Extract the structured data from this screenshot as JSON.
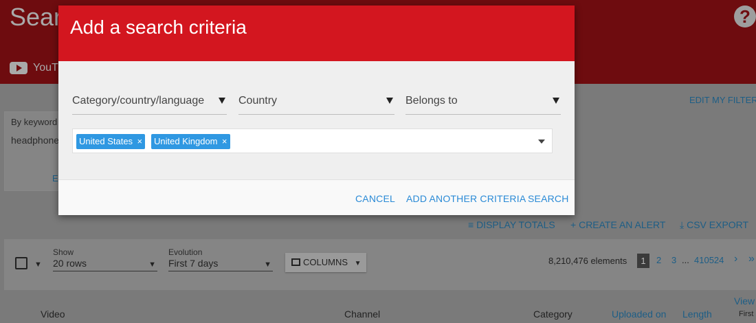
{
  "background": {
    "title": "Sear",
    "help_icon": "help-icon",
    "platform_label": "YouT",
    "filter_card": {
      "label": "By keyword",
      "value": "headphone",
      "edit": "E"
    },
    "edit_filters": "EDIT MY FILTER",
    "actions": {
      "display_totals": "DISPLAY TOTALS",
      "create_alert": "CREATE AN ALERT",
      "csv_export": "CSV EXPORT"
    },
    "toolbar": {
      "show_label": "Show",
      "show_value": "20 rows",
      "evolution_label": "Evolution",
      "evolution_value": "First 7 days",
      "columns": "COLUMNS",
      "elements": "8,210,476 elements",
      "pages": [
        "1",
        "2",
        "3",
        "...",
        "410524"
      ],
      "next": "›",
      "last": "»"
    },
    "columns": {
      "video": "Video",
      "channel": "Channel",
      "category": "Category",
      "uploaded_on": "Uploaded on",
      "length": "Length",
      "views": "View",
      "views_sub": "First"
    }
  },
  "modal": {
    "title": "Add a search criteria",
    "dropdowns": [
      {
        "label": "Category/country/language"
      },
      {
        "label": "Country"
      },
      {
        "label": "Belongs to"
      }
    ],
    "tags": [
      "United States",
      "United Kingdom"
    ],
    "tag_remove": "×",
    "footer": {
      "cancel": "CANCEL",
      "add_another": "ADD ANOTHER CRITERIA",
      "search": "SEARCH"
    }
  },
  "colors": {
    "modal_header": "#d3161f",
    "tag": "#2f98e2",
    "link": "#2a8ad6"
  }
}
